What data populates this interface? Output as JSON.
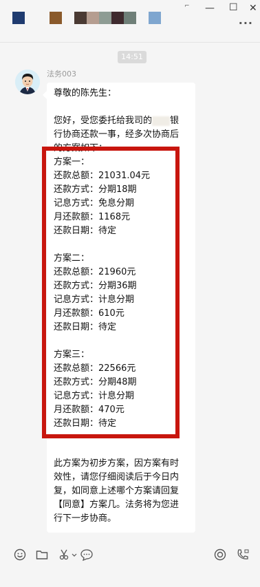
{
  "titlebar": {
    "swatches": [
      {
        "color": "#1f3b6f",
        "x": 0
      },
      {
        "color": "#8a5a2b",
        "x": 0
      },
      {
        "color": "#4a3a33",
        "x": 0
      },
      {
        "color": "#b59d90",
        "x": 0
      },
      {
        "color": "#8e9c94",
        "x": 0
      },
      {
        "color": "#3f2a2e",
        "x": 0
      },
      {
        "color": "#6f7f78",
        "x": 0
      },
      {
        "color": "#7fa6cf",
        "x": 0
      }
    ],
    "pin_glyph": "⌐",
    "minimize_glyph": "—",
    "maximize_glyph": "☐",
    "close_glyph": "✕",
    "more_glyph": "···"
  },
  "chat": {
    "timestamp": "14:51",
    "sender": "法务003",
    "message_lines": [
      "尊敬的陈先生：",
      "",
      "您好，受您委托给我司的",
      "行协商还款一事，经多次协商后",
      "的方案如下：",
      "方案一：",
      "还款总额：21031.04元",
      "还款方式：分期18期",
      "记息方式：免息分期",
      "月还款额：1168元",
      "还款日期：待定",
      "",
      "方案二：",
      "还款总额：21960元",
      "还款方式：分期36期",
      "记息方式：计息分期",
      "月还款额：610元",
      "还款日期：待定",
      "",
      "方案三：",
      "还款总额：22566元",
      "还款方式：分期48期",
      "记息方式：计息分期",
      "月还款额：470元",
      "还款日期：待定",
      "",
      "",
      "此方案为初步方案，因方案有时",
      "效性，请您仔细阅读后于今日内",
      "复，如同意上述哪个方案请回复",
      "【同意】方案几。法务将为您进",
      "行下一步协商。"
    ],
    "redacted_suffix": "银"
  },
  "colors": {
    "highlight_border": "#c8160e",
    "bubble": "#ffffff",
    "background": "#f5f5f5"
  },
  "toolbar": {
    "icons": [
      "emoji-icon",
      "folder-icon",
      "scissors-icon",
      "chat-bubble-icon",
      "record-icon",
      "phone-icon"
    ]
  }
}
